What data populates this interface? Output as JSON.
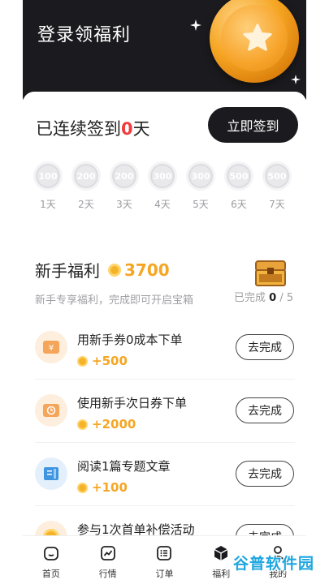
{
  "hero": {
    "title": "登录领福利"
  },
  "checkin": {
    "prefix": "已连续签到",
    "days": "0",
    "suffix": "天",
    "button": "立即签到",
    "rewards": [
      {
        "value": "100",
        "label": "1天"
      },
      {
        "value": "200",
        "label": "2天"
      },
      {
        "value": "200",
        "label": "3天"
      },
      {
        "value": "300",
        "label": "4天"
      },
      {
        "value": "300",
        "label": "5天"
      },
      {
        "value": "500",
        "label": "6天"
      },
      {
        "value": "500",
        "label": "7天"
      }
    ]
  },
  "newbie": {
    "title": "新手福利",
    "points": "3700",
    "subtitle": "新手专享福利，完成即可开启宝箱",
    "progress_prefix": "已完成",
    "progress_done": "0",
    "progress_total": "/ 5"
  },
  "tasks": [
    {
      "name": "用新手券0成本下单",
      "reward": "+500",
      "button": "去完成",
      "icon": "coupon-yen-icon",
      "icon_bg": "#fdeedd",
      "icon_color": "#f5a55a"
    },
    {
      "name": "使用新手次日券下单",
      "reward": "+2000",
      "button": "去完成",
      "icon": "coupon-clock-icon",
      "icon_bg": "#fdeedd",
      "icon_color": "#f5a55a"
    },
    {
      "name": "阅读1篇专题文章",
      "reward": "+100",
      "button": "去完成",
      "icon": "book-icon",
      "icon_bg": "#e3f0fb",
      "icon_color": "#3f95e0"
    },
    {
      "name": "参与1次首单补偿活动",
      "reward": "",
      "button": "去完成",
      "icon": "coin-icon",
      "icon_bg": "#fdeedd",
      "icon_color": "#f5a623"
    }
  ],
  "tabbar": [
    {
      "label": "首页",
      "icon": "home-icon"
    },
    {
      "label": "行情",
      "icon": "chart-icon"
    },
    {
      "label": "订单",
      "icon": "order-icon"
    },
    {
      "label": "福利",
      "icon": "box-icon"
    },
    {
      "label": "我的",
      "icon": "user-icon"
    }
  ],
  "watermark": {
    "text": "谷普软件园"
  },
  "colors": {
    "accent": "#f5a623",
    "dark": "#1b1b1f",
    "red": "#f03c3c"
  }
}
